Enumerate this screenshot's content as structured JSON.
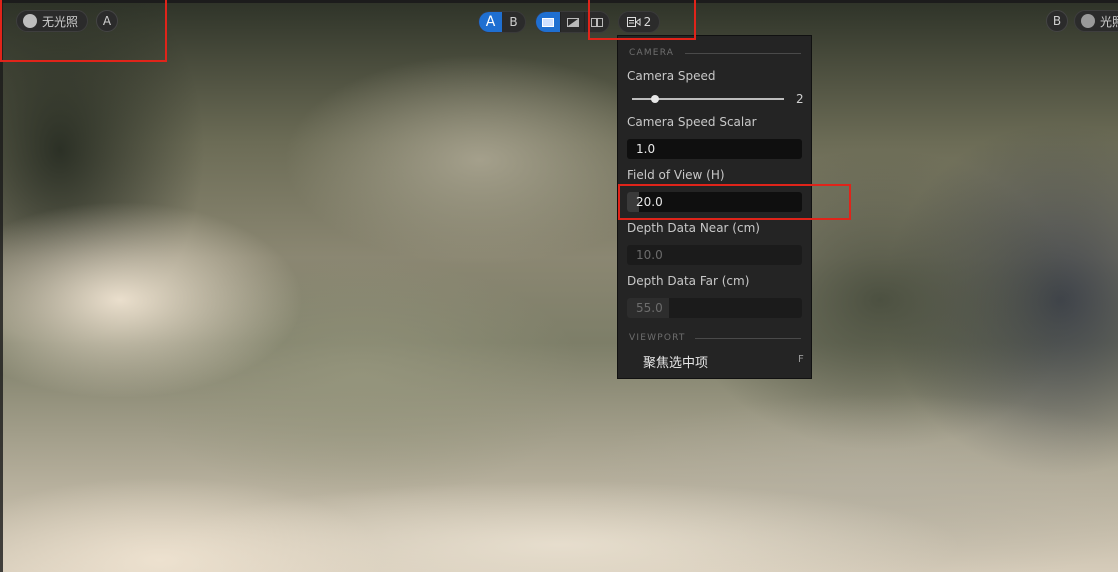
{
  "toolbar": {
    "lighting_label": "无光照",
    "left_circle_label": "A",
    "ab_a_label": "A",
    "ab_b_label": "B",
    "camera_label": "2",
    "right_circle_label": "B",
    "right_lighting_label": "光照"
  },
  "camera_panel": {
    "section_camera": "CAMERA",
    "speed_label": "Camera Speed",
    "speed_value": "2",
    "speed_fraction": 0.15,
    "scalar_label": "Camera Speed Scalar",
    "scalar_value": "1.0",
    "fov_label": "Field of View (H)",
    "fov_value": "20.0",
    "depth_near_label": "Depth Data Near (cm)",
    "depth_near_value": "10.0",
    "depth_far_label": "Depth Data Far (cm)",
    "depth_far_value": "55.0",
    "section_viewport": "VIEWPORT",
    "focus_item_label": "聚焦选中项",
    "focus_item_shortcut": "F"
  },
  "colors": {
    "accent": "#1f6fd1",
    "highlight": "#e0241a",
    "panel_bg": "#242424"
  },
  "icons": [
    "lighting-dot-icon",
    "viewport-single-icon",
    "viewport-split-icon",
    "viewport-dual-icon",
    "camera-icon"
  ]
}
